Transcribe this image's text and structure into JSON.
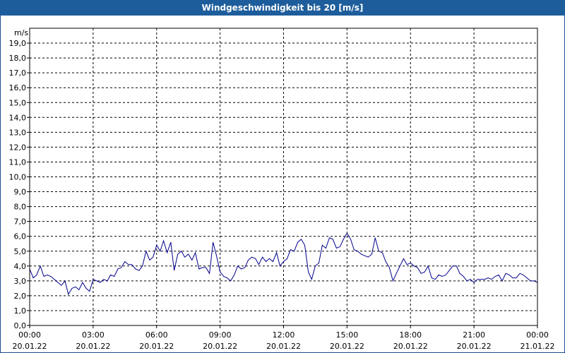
{
  "chart_data": {
    "type": "line",
    "title": "Windgeschwindigkeit bis 20 [m/s]",
    "ylabel": "m/s",
    "xlabel": "",
    "ylim": [
      0,
      20
    ],
    "y_ticks": [
      "0,0",
      "1,0",
      "2,0",
      "3,0",
      "4,0",
      "5,0",
      "6,0",
      "7,0",
      "8,0",
      "9,0",
      "10,0",
      "11,0",
      "12,0",
      "13,0",
      "14,0",
      "15,0",
      "16,0",
      "17,0",
      "18,0",
      "19,0"
    ],
    "x_ticks": [
      {
        "time": "00:00",
        "date": "20.01.22"
      },
      {
        "time": "03:00",
        "date": "20.01.22"
      },
      {
        "time": "06:00",
        "date": "20.01.22"
      },
      {
        "time": "09:00",
        "date": "20.01.22"
      },
      {
        "time": "12:00",
        "date": "20.01.22"
      },
      {
        "time": "15:00",
        "date": "20.01.22"
      },
      {
        "time": "18:00",
        "date": "20.01.22"
      },
      {
        "time": "21:00",
        "date": "20.01.22"
      },
      {
        "time": "00:00",
        "date": "21.01.22"
      }
    ],
    "grid": true,
    "series": [
      {
        "color": "#00008b",
        "x_hours": [
          0,
          0.17,
          0.33,
          0.5,
          0.67,
          0.83,
          1,
          1.17,
          1.33,
          1.5,
          1.67,
          1.83,
          2,
          2.17,
          2.33,
          2.5,
          2.67,
          2.83,
          3,
          3.17,
          3.33,
          3.5,
          3.67,
          3.83,
          4,
          4.17,
          4.33,
          4.5,
          4.67,
          4.83,
          5,
          5.17,
          5.33,
          5.5,
          5.67,
          5.83,
          6,
          6.17,
          6.33,
          6.5,
          6.67,
          6.83,
          7,
          7.17,
          7.33,
          7.5,
          7.67,
          7.83,
          8,
          8.17,
          8.33,
          8.5,
          8.67,
          8.83,
          9,
          9.17,
          9.33,
          9.5,
          9.67,
          9.83,
          10,
          10.17,
          10.33,
          10.5,
          10.67,
          10.83,
          11,
          11.17,
          11.33,
          11.5,
          11.67,
          11.83,
          12,
          12.17,
          12.33,
          12.5,
          12.67,
          12.83,
          13,
          13.17,
          13.33,
          13.5,
          13.67,
          13.83,
          14,
          14.17,
          14.33,
          14.5,
          14.67,
          14.83,
          15,
          15.17,
          15.33,
          15.5,
          15.67,
          15.83,
          16,
          16.17,
          16.33,
          16.5,
          16.67,
          16.83,
          17,
          17.17,
          17.33,
          17.5,
          17.67,
          17.83,
          18,
          18.17,
          18.33,
          18.5,
          18.67,
          18.83,
          19,
          19.17,
          19.33,
          19.5,
          19.67,
          19.83,
          20,
          20.17,
          20.33,
          20.5,
          20.67,
          20.83,
          21,
          21.17,
          21.33,
          21.5,
          21.67,
          21.83,
          22,
          22.17,
          22.33,
          22.5,
          22.67,
          22.83,
          23,
          23.17,
          23.33,
          23.5,
          23.67,
          23.83,
          24
        ],
        "values": [
          3.8,
          3.2,
          3.4,
          4.0,
          3.3,
          3.4,
          3.3,
          3.1,
          2.9,
          2.7,
          3.0,
          2.1,
          2.5,
          2.6,
          2.4,
          2.9,
          2.5,
          2.3,
          3.1,
          3.0,
          2.9,
          3.1,
          3.0,
          3.4,
          3.3,
          3.8,
          3.9,
          4.3,
          4.1,
          4.1,
          3.8,
          3.7,
          4.0,
          5.0,
          4.4,
          4.6,
          5.4,
          5.0,
          5.7,
          4.9,
          5.6,
          3.7,
          4.8,
          5.0,
          4.6,
          4.8,
          4.4,
          4.9,
          3.8,
          3.9,
          3.9,
          3.5,
          5.6,
          4.7,
          3.6,
          3.3,
          3.2,
          3.0,
          3.4,
          4.0,
          3.8,
          3.9,
          4.4,
          4.6,
          4.5,
          4.1,
          4.6,
          4.3,
          4.5,
          4.3,
          4.9,
          4.0,
          4.3,
          4.5,
          5.1,
          5.0,
          5.6,
          5.8,
          5.4,
          3.6,
          3.1,
          4.0,
          4.2,
          5.4,
          5.2,
          5.9,
          5.8,
          5.2,
          5.3,
          5.8,
          6.2,
          5.8,
          5.1,
          5.0,
          4.8,
          4.7,
          4.6,
          4.8,
          5.9,
          5.0,
          4.9,
          4.3,
          3.9,
          3.0,
          3.5,
          4.0,
          4.5,
          4.1,
          4.2,
          4.0,
          3.9,
          3.5,
          3.6,
          4.0,
          3.2,
          3.1,
          3.4,
          3.3,
          3.4,
          3.7,
          4.0,
          4.0,
          3.5,
          3.3,
          3.0,
          3.1,
          2.9,
          3.1,
          3.1,
          3.1,
          3.2,
          3.1,
          3.3,
          3.4,
          3.0,
          3.5,
          3.4,
          3.2,
          3.2,
          3.5,
          3.4,
          3.2,
          3.0,
          3.0,
          2.9,
          2.9,
          3.0
        ]
      }
    ]
  }
}
